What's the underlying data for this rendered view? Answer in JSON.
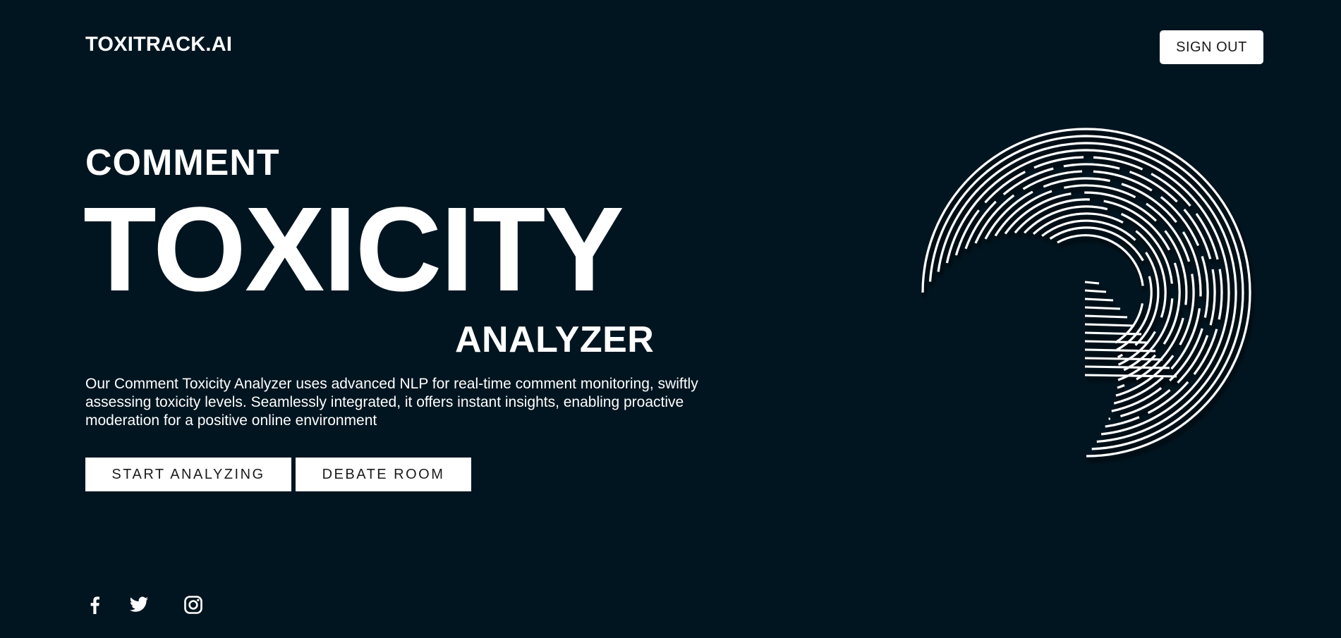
{
  "header": {
    "brand": "TOXITRACK.AI",
    "sign_out_label": "SIGN OUT"
  },
  "hero": {
    "line1": "COMMENT",
    "line2": "TOXICITY",
    "line3": "ANALYZER",
    "description": "Our Comment Toxicity Analyzer uses advanced NLP for real-time comment monitoring, swiftly assessing toxicity levels. Seamlessly integrated, it offers instant insights, enabling proactive moderation for a positive online environment"
  },
  "actions": {
    "start_label": "START ANALYZING",
    "debate_label": "DEBATE ROOM"
  },
  "social": [
    {
      "icon": "facebook-icon"
    },
    {
      "icon": "twitter-icon"
    },
    {
      "icon": "instagram-icon"
    }
  ],
  "colors": {
    "background": "#011520",
    "text": "#ffffff",
    "button_bg": "#ffffff",
    "button_text": "#1b1b1b"
  }
}
